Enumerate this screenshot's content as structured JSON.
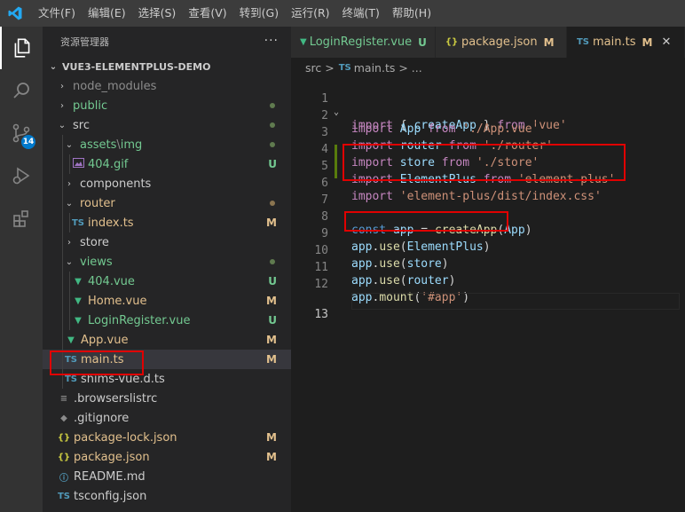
{
  "menu": [
    "文件(F)",
    "编辑(E)",
    "选择(S)",
    "查看(V)",
    "转到(G)",
    "运行(R)",
    "终端(T)",
    "帮助(H)"
  ],
  "activity": {
    "scm_badge": "14"
  },
  "sidebar": {
    "title": "资源管理器",
    "more": "···",
    "root": "VUE3-ELEMENTPLUS-DEMO",
    "items": [
      {
        "label": "node_modules",
        "status": ""
      },
      {
        "label": "public",
        "status": ""
      },
      {
        "label": "src",
        "status": ""
      },
      {
        "label": "assets",
        "sep": "\\",
        "label2": "img",
        "status": ""
      },
      {
        "label": "404.gif",
        "status": "U"
      },
      {
        "label": "components",
        "status": ""
      },
      {
        "label": "router",
        "status": ""
      },
      {
        "label": "index.ts",
        "status": "M"
      },
      {
        "label": "store",
        "status": ""
      },
      {
        "label": "views",
        "status": ""
      },
      {
        "label": "404.vue",
        "status": "U"
      },
      {
        "label": "Home.vue",
        "status": "M"
      },
      {
        "label": "LoginRegister.vue",
        "status": "U"
      },
      {
        "label": "App.vue",
        "status": "M"
      },
      {
        "label": "main.ts",
        "status": "M"
      },
      {
        "label": "shims-vue.d.ts",
        "status": ""
      },
      {
        "label": ".browserslistrc",
        "status": ""
      },
      {
        "label": ".gitignore",
        "status": ""
      },
      {
        "label": "package-lock.json",
        "status": "M"
      },
      {
        "label": "package.json",
        "status": "M"
      },
      {
        "label": "README.md",
        "status": ""
      },
      {
        "label": "tsconfig.json",
        "status": ""
      }
    ]
  },
  "tabs": [
    {
      "label": "LoginRegister.vue",
      "status": "U"
    },
    {
      "label": "package.json",
      "status": "M"
    },
    {
      "label": "main.ts",
      "status": "M"
    }
  ],
  "breadcrumb": {
    "folder": "src",
    "sep": ">",
    "file": "main.ts",
    "more": "> ..."
  },
  "editor": {
    "line_numbers": [
      "1",
      "2",
      "3",
      "4",
      "5",
      "6",
      "7",
      "8",
      "9",
      "10",
      "11",
      "12",
      "13"
    ],
    "tokens": {
      "import": "import",
      "from": "from",
      "const": "const",
      "lb": "{ ",
      "rb": " }",
      "createApp": "createApp",
      "vue": "'vue'",
      "App": "App",
      "app_vue": "'./App.vue'",
      "router": "router",
      "router_path": "'./router'",
      "store": "store",
      "store_path": "'./store'",
      "ElementPlus": "ElementPlus",
      "ep": "'element-plus'",
      "ep_css": "'element-plus/dist/index.css'",
      "app": "app",
      "eq": " = ",
      "dot": ".",
      "use": "use",
      "mount": "mount",
      "lp": "(",
      "rp": ")",
      "hash_app": "'#app'"
    }
  },
  "colors": {
    "modified": "#e2c08d",
    "untracked": "#73c991",
    "highlight": "#e00000",
    "vue_icon": "#41b883",
    "ts_icon": "#519aba",
    "json_icon": "#cbcb41"
  }
}
